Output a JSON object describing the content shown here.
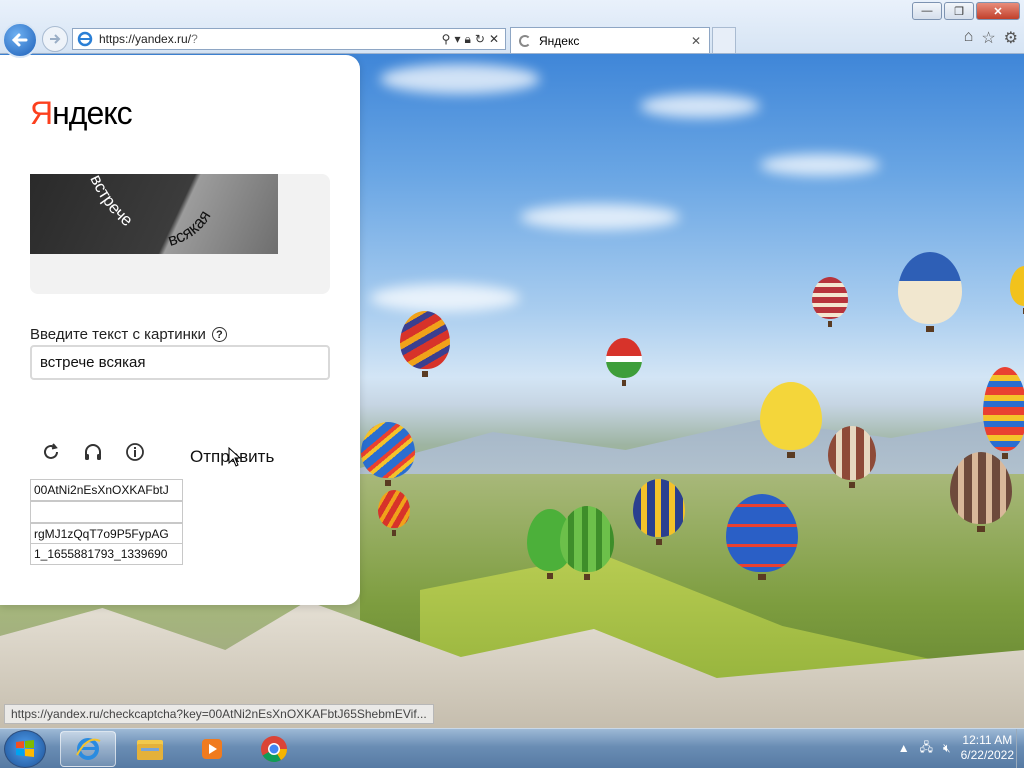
{
  "browser": {
    "address": {
      "domain": "https://yandex.ru/",
      "path": "?"
    },
    "tab_title": "Яндекс",
    "window_buttons": {
      "minimize": "—",
      "restore": "❐",
      "close": "✕"
    }
  },
  "page": {
    "logo_first": "Я",
    "logo_rest": "ндекс",
    "captcha_word_1": "встрече",
    "captcha_word_2": "всякая",
    "input_label": "Введите текст с картинки",
    "help_glyph": "?",
    "input_value": "встрече всякая",
    "submit_label": "Отправить",
    "debug_fields": [
      "00AtNi2nEsXnOXKAFbtJ",
      "",
      "rgMJ1zQqT7o9P5FypAG",
      "1_1655881793_1339690"
    ]
  },
  "status_bar": {
    "text": "https://yandex.ru/checkcaptcha?key=00AtNi2nEsXnOXKAFbtJ65ShebmEVif..."
  },
  "taskbar": {
    "time": "12:11 AM",
    "date": "6/22/2022"
  },
  "colors": {
    "yandex_red": "#fc3f1d",
    "taskbar": "#6a8db4"
  }
}
